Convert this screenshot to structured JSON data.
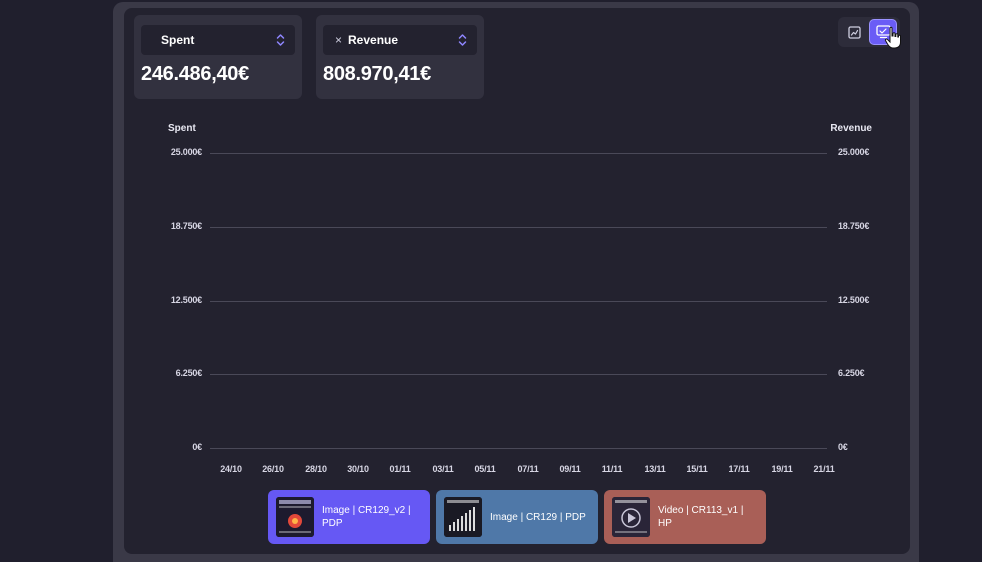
{
  "metrics": {
    "spent": {
      "label": "Spent",
      "value": "246.486,40€"
    },
    "revenue": {
      "label": "Revenue",
      "remove_symbol": "×",
      "value": "808.970,41€"
    }
  },
  "view_toggle": {
    "options": [
      "chart-icon",
      "creative-view-icon"
    ],
    "active": "creative-view-icon"
  },
  "chart_data": {
    "type": "line",
    "left_axis_title": "Spent",
    "right_axis_title": "Revenue",
    "y_ticks_left": [
      "25.000€",
      "18.750€",
      "12.500€",
      "6.250€",
      "0€"
    ],
    "y_ticks_right": [
      "25.000€",
      "18.750€",
      "12.500€",
      "6.250€",
      "0€"
    ],
    "y_values": [
      25000,
      18750,
      12500,
      6250,
      0
    ],
    "ylim": [
      0,
      25000
    ],
    "x": [
      "24/10",
      "26/10",
      "28/10",
      "30/10",
      "01/11",
      "03/11",
      "05/11",
      "07/11",
      "09/11",
      "11/11",
      "13/11",
      "15/11",
      "17/11",
      "19/11",
      "21/11"
    ],
    "grid": true,
    "series": []
  },
  "creatives": [
    {
      "label": "Image | CR129_v2 | PDP",
      "color": "#6658f4"
    },
    {
      "label": "Image | CR129 | PDP",
      "color": "#4f78a8"
    },
    {
      "label": "Video | CR113_v1 | HP",
      "color": "#a95f57"
    }
  ],
  "colors": {
    "accent": "#6a5cf6",
    "background": "#201f2d",
    "panel": "#23222f",
    "card": "#32313f"
  }
}
